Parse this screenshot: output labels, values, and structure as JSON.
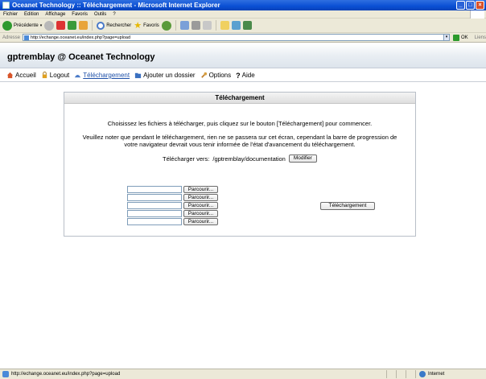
{
  "window": {
    "title": "Oceanet Technology :: Téléchargement - Microsoft Internet Explorer"
  },
  "menu": [
    "Fichier",
    "Edition",
    "Affichage",
    "Favoris",
    "Outils",
    "?"
  ],
  "toolbar": {
    "back_label": "Précédente",
    "search_label": "Rechercher",
    "favorites_label": "Favoris"
  },
  "address": {
    "label": "Adresse",
    "url": "http://echange.oceanet.eu/index.php?page=upload",
    "go_label": "OK",
    "links_label": "Liens"
  },
  "banner": {
    "title": "gptremblay @ Oceanet Technology"
  },
  "nav": [
    {
      "label": "Accueil",
      "icon": "home-icon"
    },
    {
      "label": "Logout",
      "icon": "lock-icon"
    },
    {
      "label": "Téléchargement",
      "icon": "upload-icon"
    },
    {
      "label": "Ajouter un dossier",
      "icon": "folder-add-icon"
    },
    {
      "label": "Options",
      "icon": "wrench-icon"
    },
    {
      "label": "Aide",
      "icon": "help-icon"
    }
  ],
  "panel": {
    "title": "Téléchargement",
    "instruction": "Choisissez les fichiers à télécharger, puis cliquez sur le bouton [Téléchargement] pour commencer.",
    "note": "Veuillez noter que pendant le téléchargement, rien ne se passera sur cet écran, cependant la barre de progression de votre navigateur devrait vous tenir informée de l'état d'avancement du téléchargement.",
    "dest_label": "Télécharger vers:",
    "dest_path": "/gptremblay/documentation",
    "modify_label": "Modifier",
    "browse_label": "Parcourir...",
    "upload_label": "Téléchargement"
  },
  "status": {
    "url": "http://echange.oceanet.eu/index.php?page=upload",
    "zone": "Internet"
  }
}
